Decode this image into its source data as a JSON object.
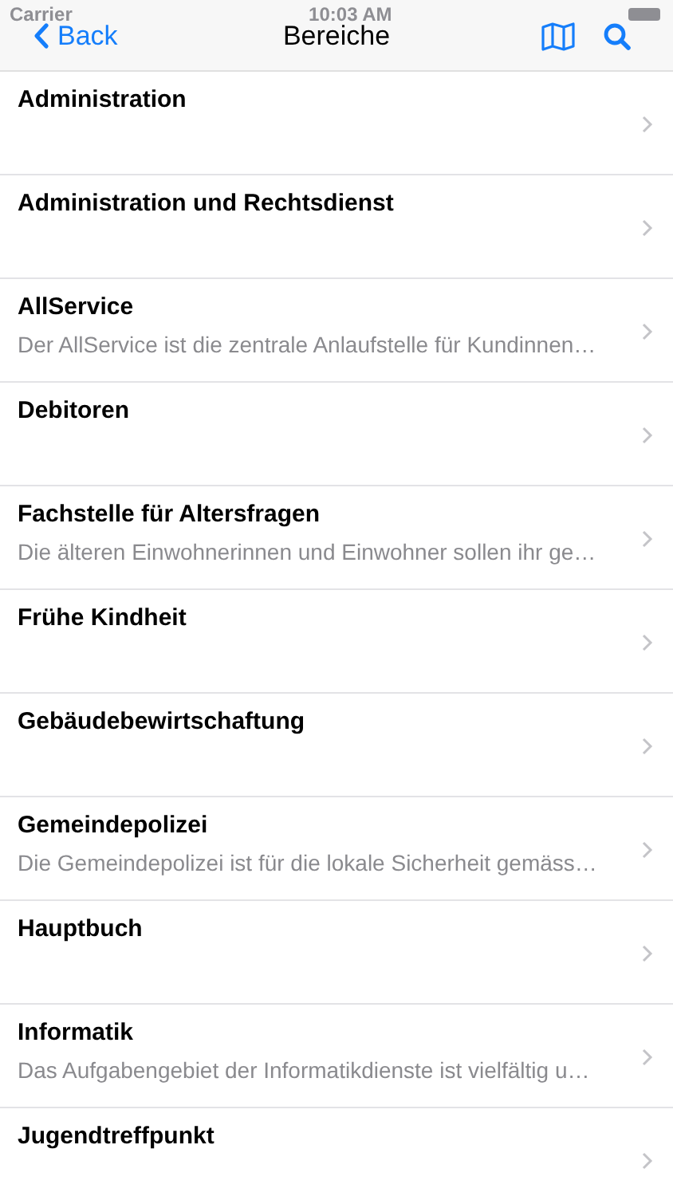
{
  "status_bar": {
    "carrier": "Carrier",
    "time": "10:03 AM"
  },
  "nav": {
    "back": "Back",
    "title": "Bereiche"
  },
  "items": [
    {
      "title": "Administration"
    },
    {
      "title": "Administration und Rechtsdienst"
    },
    {
      "title": "AllService",
      "subtitle": "Der AllService ist die zentrale Anlaufstelle für Kundinnen…"
    },
    {
      "title": "Debitoren"
    },
    {
      "title": "Fachstelle für Altersfragen",
      "subtitle": "Die älteren Einwohnerinnen und Einwohner sollen ihr ge…"
    },
    {
      "title": "Frühe Kindheit"
    },
    {
      "title": "Gebäudebewirtschaftung"
    },
    {
      "title": "Gemeindepolizei",
      "subtitle": "Die Gemeindepolizei ist für die lokale Sicherheit gemäss…"
    },
    {
      "title": "Hauptbuch"
    },
    {
      "title": "Informatik",
      "subtitle": "Das Aufgabengebiet der Informatikdienste ist vielfältig u…"
    },
    {
      "title": "Jugendtreffpunkt"
    }
  ]
}
